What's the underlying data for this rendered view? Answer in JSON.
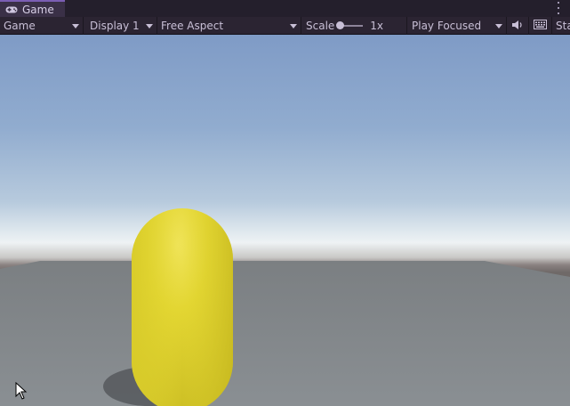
{
  "tab": {
    "title": "Game",
    "icon": "gamepad-icon"
  },
  "toolbar": {
    "mode": "Game",
    "display": "Display 1",
    "aspect": "Free Aspect",
    "scale_label": "Scale",
    "scale_value": "1x",
    "play_mode": "Play Focused",
    "stats_label": "Sta"
  },
  "colors": {
    "accent": "#7a5eb3",
    "capsule": "#e0d52a",
    "ground": "#82878a"
  }
}
